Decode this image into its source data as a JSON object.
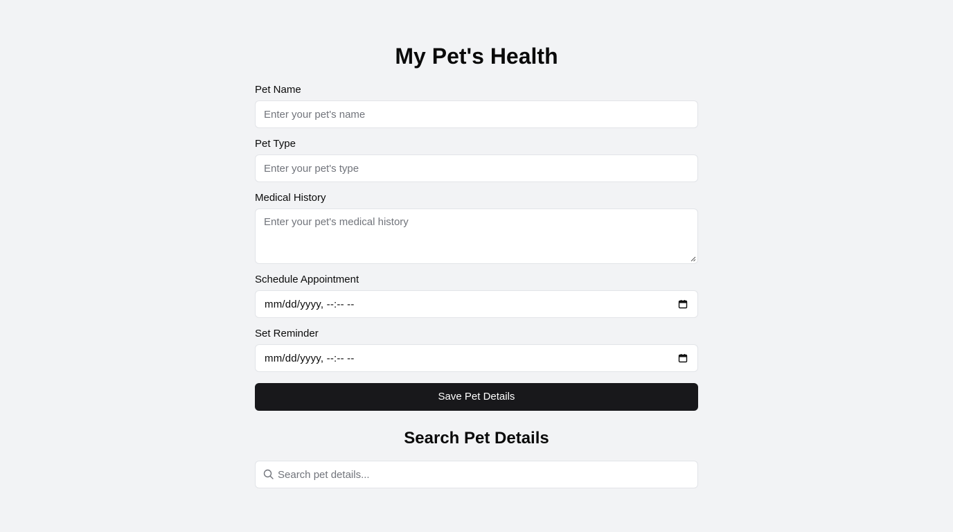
{
  "page": {
    "title": "My Pet's Health"
  },
  "form": {
    "pet_name": {
      "label": "Pet Name",
      "placeholder": "Enter your pet's name"
    },
    "pet_type": {
      "label": "Pet Type",
      "placeholder": "Enter your pet's type"
    },
    "medical_history": {
      "label": "Medical History",
      "placeholder": "Enter your pet's medical history"
    },
    "appointment": {
      "label": "Schedule Appointment",
      "value": "mm/dd/yyyy, --:-- --",
      "icon": "calendar-icon"
    },
    "reminder": {
      "label": "Set Reminder",
      "value": "mm/dd/yyyy, --:-- --",
      "icon": "calendar-icon"
    },
    "save_label": "Save Pet Details"
  },
  "search": {
    "title": "Search Pet Details",
    "placeholder": "Search pet details...",
    "icon": "search-icon"
  },
  "colors": {
    "background": "#f2f3f5",
    "button": "#18181b",
    "placeholder": "#71747b",
    "border": "#e2e4e8"
  }
}
